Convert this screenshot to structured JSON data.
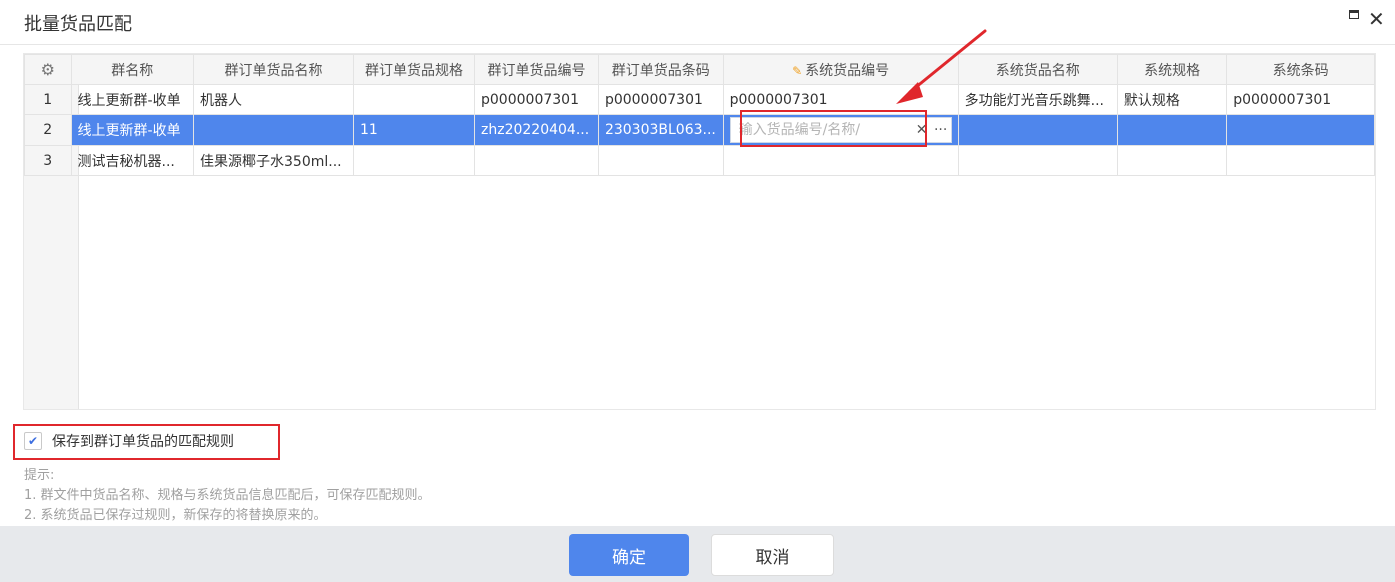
{
  "window": {
    "title": "批量货品匹配",
    "maximize_icon": "maximize-icon",
    "close_icon": "close-icon",
    "close_glyph": "✕"
  },
  "grid": {
    "settings_icon": "gear-icon",
    "settings_glyph": "⚙",
    "edit_icon": "pencil-icon",
    "edit_glyph": "✎",
    "columns": [
      "群名称",
      "群订单货品名称",
      "群订单货品规格",
      "群订单货品编号",
      "群订单货品条码",
      "系统货品编号",
      "系统货品名称",
      "系统规格",
      "系统条码"
    ],
    "rows": [
      [
        "1",
        "线上更新群-收单",
        "机器人",
        "",
        "p0000007301",
        "p0000007301",
        "p0000007301",
        "多功能灯光音乐跳舞...",
        "默认规格",
        "p0000007301"
      ],
      [
        "2",
        "线上更新群-收单",
        "",
        "11",
        "zhz20220404...",
        "230303BL063...",
        "",
        "",
        "",
        ""
      ],
      [
        "3",
        "测试吉秘机器...",
        "佳果源椰子水350ml...",
        "",
        "",
        "",
        "",
        "",
        "",
        ""
      ]
    ],
    "selected_row": 2,
    "editor": {
      "placeholder": "输入货品编号/名称/",
      "value": "",
      "clear_glyph": "✕",
      "more_glyph": "···"
    }
  },
  "save_rule": {
    "checked": true,
    "check_glyph": "✔",
    "label": "保存到群订单货品的匹配规则"
  },
  "tips": {
    "heading": "提示:",
    "lines": [
      "1. 群文件中货品名称、规格与系统货品信息匹配后，可保存匹配规则。",
      "2. 系统货品已保存过规则，新保存的将替换原来的。"
    ]
  },
  "footer": {
    "ok_label": "确定",
    "cancel_label": "取消"
  },
  "annotation_color": "#e0272c",
  "accent_color": "#4f86ec"
}
